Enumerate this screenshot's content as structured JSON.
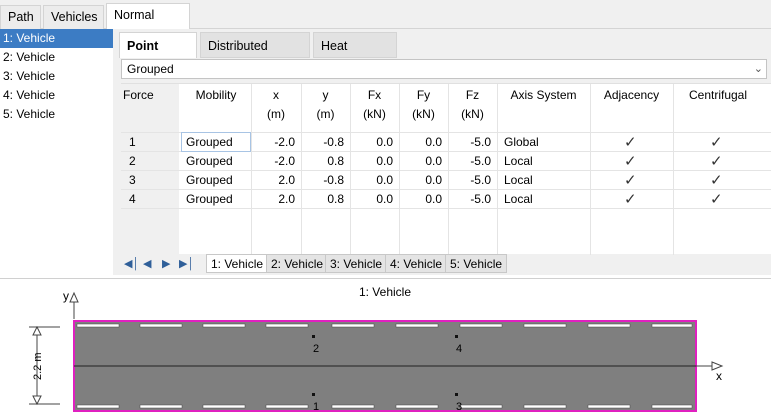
{
  "top_tabs": [
    "Path",
    "Vehicles",
    "Normal Load"
  ],
  "vehicles": [
    "1: Vehicle",
    "2: Vehicle",
    "3: Vehicle",
    "4: Vehicle",
    "5: Vehicle"
  ],
  "load_tabs": [
    "Point Force",
    "Distributed Force",
    "Heat Source"
  ],
  "group_select": {
    "value": "Grouped"
  },
  "table": {
    "headers": {
      "force": "Force",
      "mobility": "Mobility",
      "x": "x",
      "x_unit": "(m)",
      "y": "y",
      "y_unit": "(m)",
      "fx": "Fx",
      "fx_unit": "(kN)",
      "fy": "Fy",
      "fy_unit": "(kN)",
      "fz": "Fz",
      "fz_unit": "(kN)",
      "axis": "Axis System",
      "adjacency": "Adjacency",
      "centrifugal": "Centrifugal"
    },
    "rows": [
      {
        "force": "1",
        "mobility": "Grouped",
        "x": "-2.0",
        "y": "-0.8",
        "fx": "0.0",
        "fy": "0.0",
        "fz": "-5.0",
        "axis": "Global",
        "adjacency": "✓",
        "centrifugal": "✓"
      },
      {
        "force": "2",
        "mobility": "Grouped",
        "x": "-2.0",
        "y": "0.8",
        "fx": "0.0",
        "fy": "0.0",
        "fz": "-5.0",
        "axis": "Local",
        "adjacency": "✓",
        "centrifugal": "✓"
      },
      {
        "force": "3",
        "mobility": "Grouped",
        "x": "2.0",
        "y": "-0.8",
        "fx": "0.0",
        "fy": "0.0",
        "fz": "-5.0",
        "axis": "Local",
        "adjacency": "✓",
        "centrifugal": "✓"
      },
      {
        "force": "4",
        "mobility": "Grouped",
        "x": "2.0",
        "y": "0.8",
        "fx": "0.0",
        "fy": "0.0",
        "fz": "-5.0",
        "axis": "Local",
        "adjacency": "✓",
        "centrifugal": "✓"
      }
    ]
  },
  "nav": {
    "icons": [
      "first-icon",
      "prev-icon",
      "next-icon",
      "last-icon"
    ],
    "tabs": [
      "1: Vehicle",
      "2: Vehicle",
      "3: Vehicle",
      "4: Vehicle",
      "5: Vehicle"
    ]
  },
  "diagram": {
    "title": "1: Vehicle",
    "y_axis_label": "y",
    "x_axis_label": "x",
    "width_label": "2.2 m",
    "point_labels": [
      "2",
      "4",
      "1",
      "3"
    ],
    "colors": {
      "road": "#7f7f7f",
      "border": "#e020c0",
      "lane": "#ffffff"
    }
  }
}
